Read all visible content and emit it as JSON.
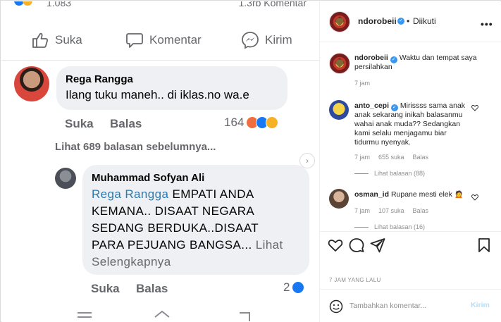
{
  "media": {
    "top_counts": {
      "reactions_suffix": "1.083",
      "comments": "1.3rb Komentar"
    },
    "actions": {
      "like": "Suka",
      "comment": "Komentar",
      "send": "Kirim"
    },
    "comment1": {
      "name": "Rega Rangga",
      "text": "Ilang tuku maneh.. di iklas.no wa.e",
      "like": "Suka",
      "reply": "Balas",
      "reaction_count": "164"
    },
    "previous_replies": "Lihat 689 balasan sebelumnya...",
    "comment2": {
      "name": "Muhammad Sofyan Ali",
      "mention": "Rega Rangga",
      "text_line1_rest": " EMPATI ANDA",
      "text_line2": "KEMANA.. DISAAT NEGARA",
      "text_line3": "SEDANG BERDUKA..DISAAT",
      "text_line4": "PARA PEJUANG BANGSA...",
      "see_more_a": "Lihat",
      "see_more_b": "Selengkapnya",
      "like": "Suka",
      "reply": "Balas",
      "reaction_count": "2"
    }
  },
  "header": {
    "username": "ndorobeii",
    "separator": "•",
    "follow_status": "Diikuti"
  },
  "caption": {
    "username": "ndorobeii",
    "text": "Waktu dan tempat saya persilahkan",
    "time": "7 jam"
  },
  "comments": [
    {
      "username": "anto_cepi",
      "text": "Mirissss sama anak anak sekarang inikah balasanmu wahai anak muda?? Sedangkan kami selalu menjagamu biar tidurmu nyenyak.",
      "time": "7 jam",
      "likes": "655 suka",
      "reply": "Balas",
      "view_replies": "Lihat balasan (88)"
    },
    {
      "username": "osman_id",
      "text": "Rupane mesti elek",
      "time": "7 jam",
      "likes": "107 suka",
      "reply": "Balas",
      "view_replies": "Lihat balasan (16)"
    }
  ],
  "post_time": "7 JAM YANG LALU",
  "composer": {
    "placeholder": "Tambahkan komentar...",
    "post_label": "Kirim"
  },
  "colors": {
    "verified": "#3897f0",
    "mention": "#2a7ab0",
    "post_disabled": "#b2dffc"
  }
}
